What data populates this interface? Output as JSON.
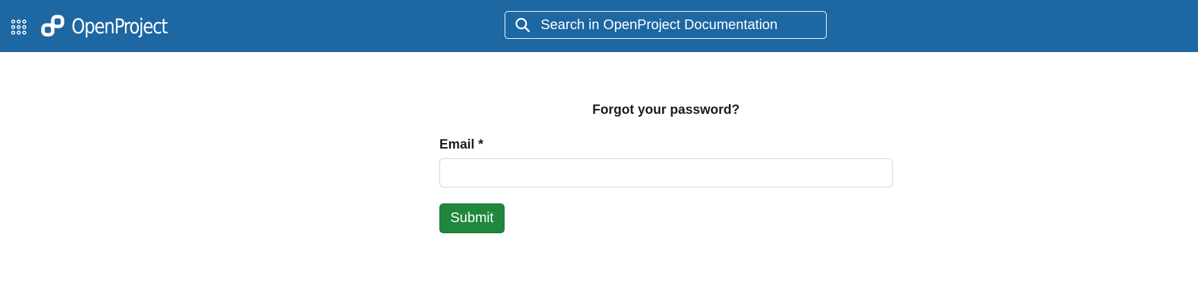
{
  "header": {
    "brand": "OpenProject",
    "apps_icon": "grid-apps-icon",
    "logo_icon": "openproject-logo-icon",
    "background_color": "#1d67a3"
  },
  "search": {
    "placeholder": "Search in OpenProject Documentation",
    "icon": "search-icon"
  },
  "form": {
    "title": "Forgot your password?",
    "email_label": "Email *",
    "email_value": "",
    "submit_label": "Submit",
    "submit_color": "#1f883d"
  }
}
